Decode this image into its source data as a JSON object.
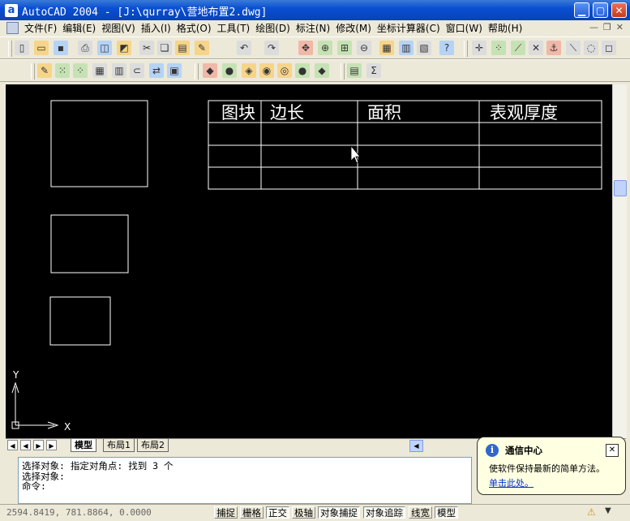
{
  "window": {
    "title": "AutoCAD 2004 - [J:\\qurray\\营地布置2.dwg]",
    "app_icon_letter": "a"
  },
  "menu": [
    "文件(F)",
    "编辑(E)",
    "视图(V)",
    "插入(I)",
    "格式(O)",
    "工具(T)",
    "绘图(D)",
    "标注(N)",
    "修改(M)",
    "坐标计算器(C)",
    "窗口(W)",
    "帮助(H)"
  ],
  "drawing": {
    "table_headers": [
      "图块",
      "边长",
      "面积",
      "表观厚度"
    ],
    "axis_y": "Y",
    "axis_x": "X"
  },
  "layout_tabs": [
    "模型",
    "布局1",
    "布局2"
  ],
  "command_lines": [
    "选择对象: 指定对角点: 找到 3 个",
    "选择对象:",
    "命令:"
  ],
  "status": {
    "coordinates": "2594.8419, 781.8864, 0.0000",
    "toggles": [
      {
        "label": "捕捉",
        "on": false
      },
      {
        "label": "栅格",
        "on": false
      },
      {
        "label": "正交",
        "on": true
      },
      {
        "label": "极轴",
        "on": false
      },
      {
        "label": "对象捕捉",
        "on": true
      },
      {
        "label": "对象追踪",
        "on": true
      },
      {
        "label": "线宽",
        "on": false
      },
      {
        "label": "模型",
        "on": true
      }
    ]
  },
  "balloon": {
    "title": "通信中心",
    "body": "使软件保持最新的简单方法。",
    "link": "单击此处。"
  },
  "colors": {
    "titlebar": "#0a4fd3",
    "canvas": "#000000",
    "balloon": "#ffffe1"
  }
}
